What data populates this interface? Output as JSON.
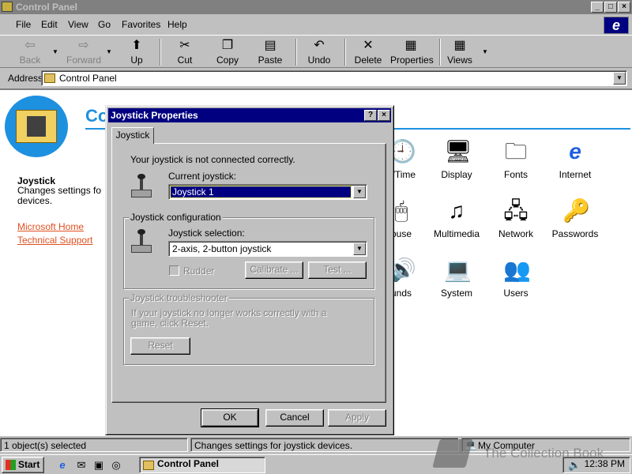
{
  "window": {
    "title": "Control Panel"
  },
  "menu": [
    "File",
    "Edit",
    "View",
    "Go",
    "Favorites",
    "Help"
  ],
  "toolbar": {
    "back": "Back",
    "forward": "Forward",
    "up": "Up",
    "cut": "Cut",
    "copy": "Copy",
    "paste": "Paste",
    "undo": "Undo",
    "delete": "Delete",
    "properties": "Properties",
    "views": "Views"
  },
  "address": {
    "label": "Address",
    "value": "Control Panel"
  },
  "content": {
    "heading_fragment": "Co",
    "info_title": "Joystick",
    "info_desc": "Changes settings fo devices.",
    "links": [
      "Microsoft Home",
      "Technical Support"
    ],
    "icons": [
      {
        "label": "e/Time",
        "icon": "clock-icon"
      },
      {
        "label": "Display",
        "icon": "display-icon"
      },
      {
        "label": "Fonts",
        "icon": "fonts-icon"
      },
      {
        "label": "Internet",
        "icon": "internet-icon"
      },
      {
        "label": "ouse",
        "icon": "mouse-icon"
      },
      {
        "label": "Multimedia",
        "icon": "multimedia-icon"
      },
      {
        "label": "Network",
        "icon": "network-icon"
      },
      {
        "label": "Passwords",
        "icon": "passwords-icon"
      },
      {
        "label": "unds",
        "icon": "sounds-icon"
      },
      {
        "label": "System",
        "icon": "system-icon"
      },
      {
        "label": "Users",
        "icon": "users-icon"
      }
    ]
  },
  "dialog": {
    "title": "Joystick Properties",
    "tab": "Joystick",
    "status_message": "Your joystick is not connected correctly.",
    "current_joystick_label": "Current joystick:",
    "current_joystick_value": "Joystick 1",
    "config_group": "Joystick configuration",
    "selection_label": "Joystick selection:",
    "selection_value": "2-axis, 2-button joystick",
    "rudder_label": "Rudder",
    "calibrate": "Calibrate ...",
    "test": "Test ...",
    "trouble_group": "Joystick troubleshooter",
    "trouble_text": "If your joystick no longer works correctly with a game, click Reset.",
    "reset": "Reset",
    "ok": "OK",
    "cancel": "Cancel",
    "apply": "Apply"
  },
  "status": {
    "objects": "1 object(s) selected",
    "description": "Changes settings for joystick devices.",
    "zone": "My Computer"
  },
  "taskbar": {
    "start": "Start",
    "task": "Control Panel",
    "time": "12:38 PM"
  },
  "watermark": "The Collection Book"
}
